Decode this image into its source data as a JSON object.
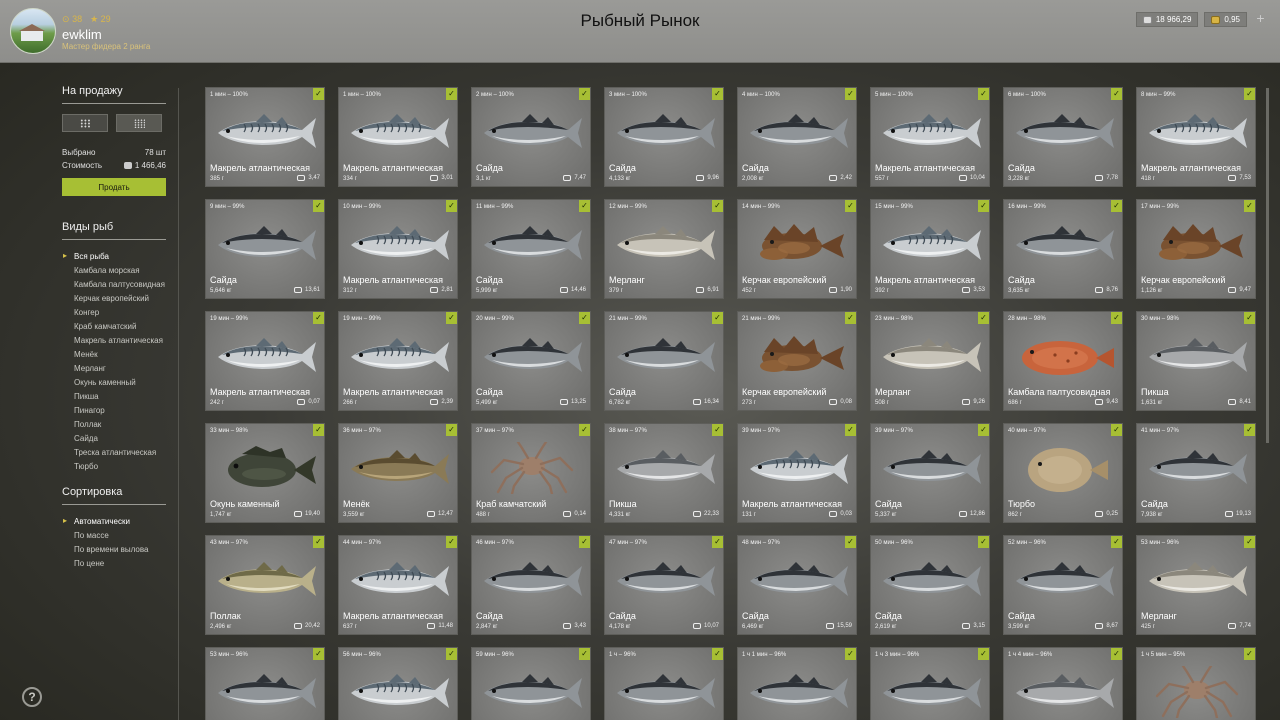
{
  "header": {
    "title": "Рыбный Рынок",
    "username": "ewklim",
    "rank": "Мастер фидера 2 ранга",
    "stat_level": "38",
    "stat_fame": "29",
    "silver": "18 966,29",
    "gold": "0,95"
  },
  "sidebar": {
    "sale_title": "На продажу",
    "selected_label": "Выбрано",
    "selected_value": "78 шт",
    "cost_label": "Стоимость",
    "cost_value": "1 466,46",
    "sell_label": "Продать",
    "species_title": "Виды рыб",
    "species": [
      "Вся рыба",
      "Камбала морская",
      "Камбала палтусовидная",
      "Керчак европейский",
      "Конгер",
      "Краб камчатский",
      "Макрель атлантическая",
      "Менёк",
      "Мерланг",
      "Окунь каменный",
      "Пикша",
      "Пинагор",
      "Поллак",
      "Сайда",
      "Треска атлантическая",
      "Тюрбо"
    ],
    "species_active": 0,
    "sort_title": "Сортировка",
    "sort": [
      "Автоматически",
      "По массе",
      "По времени вылова",
      "По цене"
    ],
    "sort_active": 0
  },
  "cards": [
    {
      "time": "1 мин – 100%",
      "name": "Макрель атлантическая",
      "weight": "385 г",
      "price": "3,47",
      "kind": "mackerel"
    },
    {
      "time": "1 мин – 100%",
      "name": "Макрель атлантическая",
      "weight": "334 г",
      "price": "3,01",
      "kind": "mackerel"
    },
    {
      "time": "2 мин – 100%",
      "name": "Сайда",
      "weight": "3,1 кг",
      "price": "7,47",
      "kind": "saithe"
    },
    {
      "time": "3 мин – 100%",
      "name": "Сайда",
      "weight": "4,133 кг",
      "price": "9,96",
      "kind": "saithe"
    },
    {
      "time": "4 мин – 100%",
      "name": "Сайда",
      "weight": "2,008 кг",
      "price": "2,42",
      "kind": "saithe"
    },
    {
      "time": "5 мин – 100%",
      "name": "Макрель атлантическая",
      "weight": "557 г",
      "price": "10,04",
      "kind": "mackerel"
    },
    {
      "time": "6 мин – 100%",
      "name": "Сайда",
      "weight": "3,228 кг",
      "price": "7,78",
      "kind": "saithe"
    },
    {
      "time": "8 мин – 99%",
      "name": "Макрель атлантическая",
      "weight": "418 г",
      "price": "7,53",
      "kind": "mackerel"
    },
    {
      "time": "9 мин – 99%",
      "name": "Сайда",
      "weight": "5,646 кг",
      "price": "13,61",
      "kind": "saithe"
    },
    {
      "time": "10 мин – 99%",
      "name": "Макрель атлантическая",
      "weight": "312 г",
      "price": "2,81",
      "kind": "mackerel"
    },
    {
      "time": "11 мин – 99%",
      "name": "Сайда",
      "weight": "5,999 кг",
      "price": "14,46",
      "kind": "saithe"
    },
    {
      "time": "12 мин – 99%",
      "name": "Мерланг",
      "weight": "379 г",
      "price": "6,91",
      "kind": "whiting"
    },
    {
      "time": "14 мин – 99%",
      "name": "Керчак европейский",
      "weight": "452 г",
      "price": "1,90",
      "kind": "sculpin"
    },
    {
      "time": "15 мин – 99%",
      "name": "Макрель атлантическая",
      "weight": "392 г",
      "price": "3,53",
      "kind": "mackerel"
    },
    {
      "time": "16 мин – 99%",
      "name": "Сайда",
      "weight": "3,635 кг",
      "price": "8,76",
      "kind": "saithe"
    },
    {
      "time": "17 мин – 99%",
      "name": "Керчак европейский",
      "weight": "1,126 кг",
      "price": "9,47",
      "kind": "sculpin"
    },
    {
      "time": "19 мин – 99%",
      "name": "Макрель атлантическая",
      "weight": "242 г",
      "price": "0,07",
      "kind": "mackerel"
    },
    {
      "time": "19 мин – 99%",
      "name": "Макрель атлантическая",
      "weight": "266 г",
      "price": "2,39",
      "kind": "mackerel"
    },
    {
      "time": "20 мин – 99%",
      "name": "Сайда",
      "weight": "5,499 кг",
      "price": "13,25",
      "kind": "saithe"
    },
    {
      "time": "21 мин – 99%",
      "name": "Сайда",
      "weight": "6,782 кг",
      "price": "16,34",
      "kind": "saithe"
    },
    {
      "time": "21 мин – 99%",
      "name": "Керчак европейский",
      "weight": "273 г",
      "price": "0,08",
      "kind": "sculpin"
    },
    {
      "time": "23 мин – 98%",
      "name": "Мерланг",
      "weight": "508 г",
      "price": "9,26",
      "kind": "whiting"
    },
    {
      "time": "28 мин – 98%",
      "name": "Камбала палтусовидная",
      "weight": "686 г",
      "price": "9,43",
      "kind": "flounder"
    },
    {
      "time": "30 мин – 98%",
      "name": "Пикша",
      "weight": "1,631 кг",
      "price": "8,41",
      "kind": "haddock"
    },
    {
      "time": "33 мин – 98%",
      "name": "Окунь каменный",
      "weight": "1,747 кг",
      "price": "19,40",
      "kind": "bass"
    },
    {
      "time": "36 мин – 97%",
      "name": "Менёк",
      "weight": "3,559 кг",
      "price": "12,47",
      "kind": "tusk"
    },
    {
      "time": "37 мин – 97%",
      "name": "Краб камчатский",
      "weight": "488 г",
      "price": "0,14",
      "kind": "crab"
    },
    {
      "time": "38 мин – 97%",
      "name": "Пикша",
      "weight": "4,331 кг",
      "price": "22,33",
      "kind": "haddock"
    },
    {
      "time": "39 мин – 97%",
      "name": "Макрель атлантическая",
      "weight": "131 г",
      "price": "0,03",
      "kind": "mackerel"
    },
    {
      "time": "39 мин – 97%",
      "name": "Сайда",
      "weight": "5,337 кг",
      "price": "12,86",
      "kind": "saithe"
    },
    {
      "time": "40 мин – 97%",
      "name": "Тюрбо",
      "weight": "862 г",
      "price": "0,25",
      "kind": "turbot"
    },
    {
      "time": "41 мин – 97%",
      "name": "Сайда",
      "weight": "7,938 кг",
      "price": "19,13",
      "kind": "saithe"
    },
    {
      "time": "43 мин – 97%",
      "name": "Поллак",
      "weight": "2,496 кг",
      "price": "20,42",
      "kind": "pollack"
    },
    {
      "time": "44 мин – 97%",
      "name": "Макрель атлантическая",
      "weight": "637 г",
      "price": "11,48",
      "kind": "mackerel"
    },
    {
      "time": "46 мин – 97%",
      "name": "Сайда",
      "weight": "2,847 кг",
      "price": "3,43",
      "kind": "saithe"
    },
    {
      "time": "47 мин – 97%",
      "name": "Сайда",
      "weight": "4,178 кг",
      "price": "10,07",
      "kind": "saithe"
    },
    {
      "time": "48 мин – 97%",
      "name": "Сайда",
      "weight": "6,469 кг",
      "price": "15,59",
      "kind": "saithe"
    },
    {
      "time": "50 мин – 96%",
      "name": "Сайда",
      "weight": "2,619 кг",
      "price": "3,15",
      "kind": "saithe"
    },
    {
      "time": "52 мин – 96%",
      "name": "Сайда",
      "weight": "3,599 кг",
      "price": "8,67",
      "kind": "saithe"
    },
    {
      "time": "53 мин – 96%",
      "name": "Мерланг",
      "weight": "425 г",
      "price": "7,74",
      "kind": "whiting"
    },
    {
      "time": "53 мин – 96%",
      "name": "",
      "weight": "",
      "price": "",
      "kind": "saithe"
    },
    {
      "time": "56 мин – 96%",
      "name": "",
      "weight": "",
      "price": "",
      "kind": "mackerel"
    },
    {
      "time": "59 мин – 96%",
      "name": "",
      "weight": "",
      "price": "",
      "kind": "saithe"
    },
    {
      "time": "1 ч – 96%",
      "name": "",
      "weight": "",
      "price": "",
      "kind": "saithe"
    },
    {
      "time": "1 ч 1 мин – 96%",
      "name": "",
      "weight": "",
      "price": "",
      "kind": "saithe"
    },
    {
      "time": "1 ч 3 мин – 96%",
      "name": "",
      "weight": "",
      "price": "",
      "kind": "saithe"
    },
    {
      "time": "1 ч 4 мин – 96%",
      "name": "",
      "weight": "",
      "price": "",
      "kind": "haddock"
    },
    {
      "time": "1 ч 5 мин – 95%",
      "name": "",
      "weight": "",
      "price": "",
      "kind": "crab"
    }
  ],
  "colors": {
    "accent": "#a7bf34",
    "header_bg": "#959592",
    "card_bg": "#7c7c7a"
  }
}
